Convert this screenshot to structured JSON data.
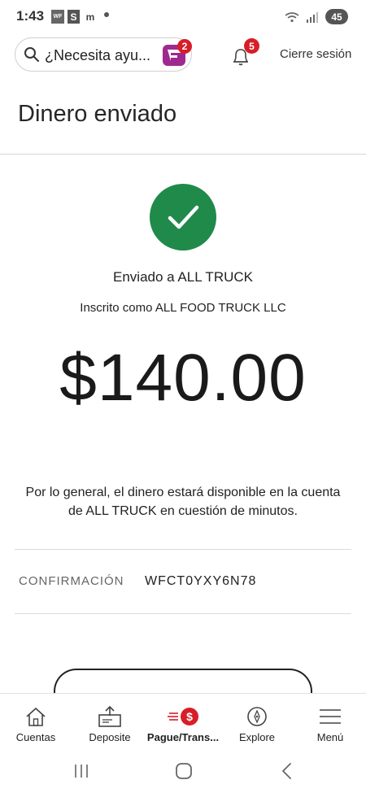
{
  "status_bar": {
    "time": "1:43",
    "apps": [
      "WF",
      "S",
      "m"
    ],
    "battery": "45"
  },
  "header": {
    "search_placeholder": "¿Necesita ayu...",
    "assistant_badge": "2",
    "notifications_badge": "5",
    "logout_label": "Cierre sesión"
  },
  "page": {
    "title": "Dinero enviado"
  },
  "confirmation": {
    "sent_to": "Enviado a ALL TRUCK",
    "enrolled_as": "Inscrito como ALL FOOD TRUCK LLC",
    "amount": "$140.00",
    "availability_message": "Por lo general, el dinero estará disponible en la cuenta de ALL TRUCK en cuestión de minutos.",
    "confirmation_label": "CONFIRMACIÓN",
    "confirmation_code": "WFCT0YXY6N78"
  },
  "bottom_nav": {
    "items": [
      {
        "label": "Cuentas",
        "icon": "home-icon"
      },
      {
        "label": "Deposite",
        "icon": "deposit-icon"
      },
      {
        "label": "Pague/Trans...",
        "icon": "pay-transfer-icon",
        "active": true
      },
      {
        "label": "Explore",
        "icon": "compass-icon"
      },
      {
        "label": "Menú",
        "icon": "hamburger-menu-icon"
      }
    ]
  },
  "colors": {
    "success_green": "#1f8a4a",
    "brand_red": "#d71e28",
    "assistant_purple": "#9e2a8f"
  }
}
